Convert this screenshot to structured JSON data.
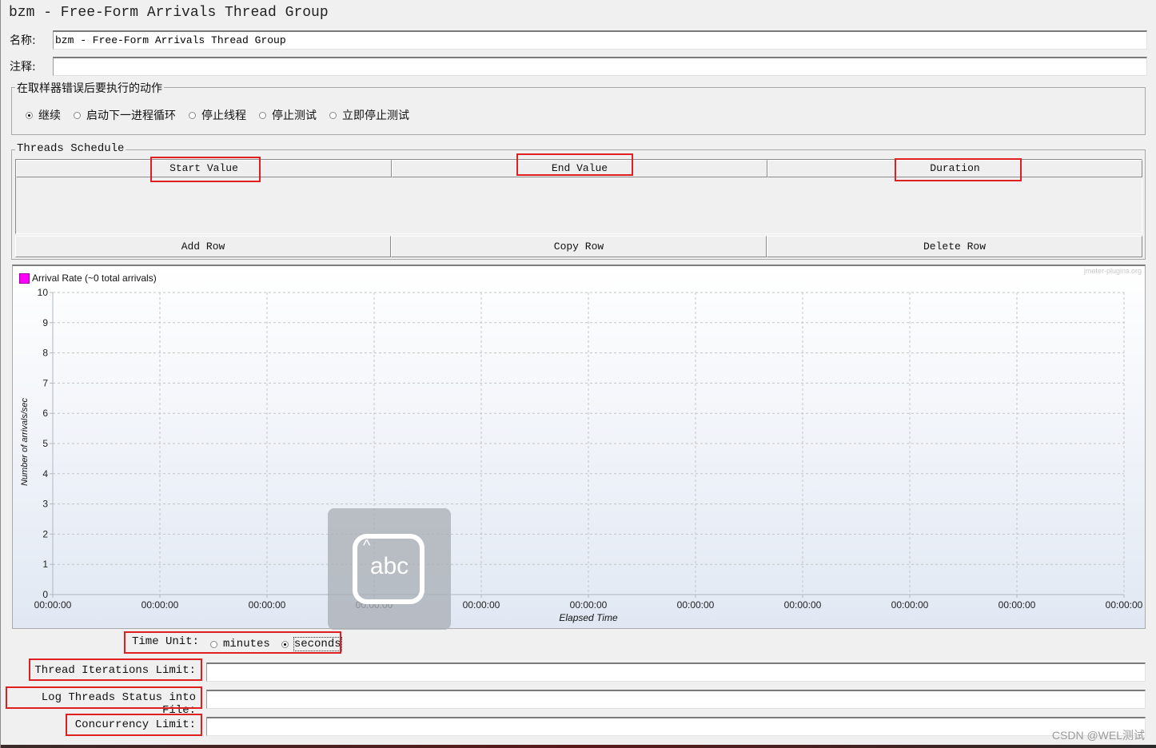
{
  "window": {
    "title": "bzm - Free-Form Arrivals Thread Group"
  },
  "form": {
    "name_label": "名称:",
    "name_value": "bzm - Free-Form Arrivals Thread Group",
    "comment_label": "注释:",
    "comment_value": ""
  },
  "sampler_error": {
    "title": "在取样器错误后要执行的动作",
    "options": [
      {
        "label": "继续",
        "selected": true
      },
      {
        "label": "启动下一进程循环",
        "selected": false
      },
      {
        "label": "停止线程",
        "selected": false
      },
      {
        "label": "停止测试",
        "selected": false
      },
      {
        "label": "立即停止测试",
        "selected": false
      }
    ]
  },
  "schedule": {
    "title": "Threads Schedule",
    "columns": [
      "Start Value",
      "End Value",
      "Duration"
    ],
    "rows": [],
    "buttons": {
      "add": "Add Row",
      "copy": "Copy Row",
      "delete": "Delete Row"
    }
  },
  "chart_data": {
    "type": "line",
    "title": "",
    "watermark": "jmeter-plugins.org",
    "legend": [
      {
        "name": "Arrival Rate (~0 total arrivals)",
        "color": "#ff00ff"
      }
    ],
    "legend_position": "top-left",
    "xlabel": "Elapsed Time",
    "ylabel": "Number of arrivals/sec",
    "ylim": [
      0,
      10
    ],
    "yticks": [
      "0",
      "1",
      "2",
      "3",
      "4",
      "5",
      "6",
      "7",
      "8",
      "9",
      "10"
    ],
    "xticks": [
      "00:00:00",
      "00:00:00",
      "00:00:00",
      "00:00:00",
      "00:00:00",
      "00:00:00",
      "00:00:00",
      "00:00:00",
      "00:00:00",
      "00:00:00",
      "00:00:00"
    ],
    "grid": true,
    "series": [
      {
        "name": "Arrival Rate",
        "values": []
      }
    ]
  },
  "time_unit": {
    "label": "Time Unit:",
    "options": [
      {
        "label": "minutes",
        "selected": false
      },
      {
        "label": "seconds",
        "selected": true
      }
    ]
  },
  "limits": {
    "iterations_label": "Thread Iterations Limit:",
    "iterations_value": "",
    "log_label": "Log Threads Status into File:",
    "log_value": "",
    "concurrency_label": "Concurrency Limit:",
    "concurrency_value": ""
  },
  "overlay": {
    "ime_icon_text": "abc",
    "watermark": "CSDN @WEL测试"
  },
  "annotation_color": "#e02020"
}
